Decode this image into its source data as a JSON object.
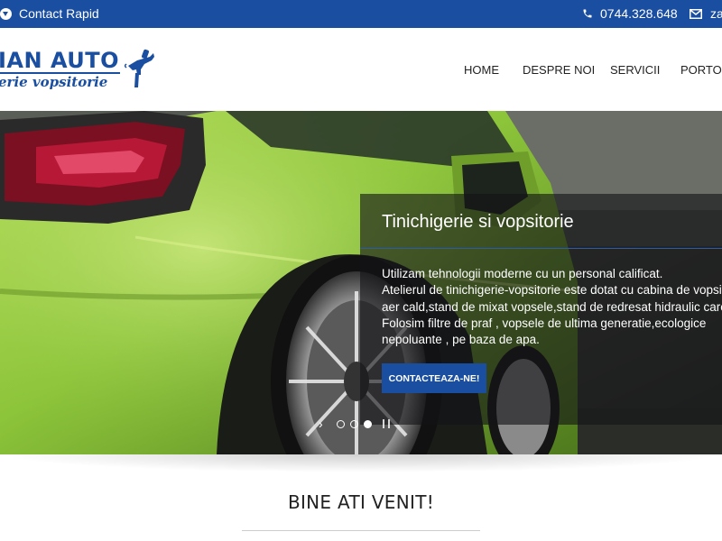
{
  "topbar": {
    "contact_label": "Contact Rapid",
    "phone": "0744.328.648",
    "email": "za"
  },
  "logo": {
    "line1": "IAN AUTO",
    "line2": "erie vopsitorie"
  },
  "nav": {
    "items": [
      {
        "label": "HOME"
      },
      {
        "label": "DESPRE NOI"
      },
      {
        "label": "SERVICII"
      },
      {
        "label": "PORTOFO"
      }
    ]
  },
  "slider": {
    "title": "Tinichigerie si vopsitorie",
    "lines": [
      "Utilizam tehnologii moderne cu un personal calificat.",
      "Atelierul de tinichigerie-vopsitorie este dotat cu cabina de vopsit c",
      "aer cald,stand de mixat vopsele,stand de redresat hidraulic caros",
      "Folosim filtre de praf , vopsele de ultima generatie,ecologice",
      "nepoluante , pe baza de apa."
    ],
    "button_label": "CONTACTEAZA-NE!",
    "active_slide": 3,
    "slide_count": 3
  },
  "welcome": {
    "title": "BINE ATI VENIT!"
  },
  "colors": {
    "brand": "#1a4ea0",
    "car_green": "#8cc43a"
  },
  "icons": {
    "contact": "circle-arrow-down-icon",
    "phone": "phone-icon",
    "mail": "envelope-icon",
    "logo_graphic": "spray-gun-icon"
  }
}
